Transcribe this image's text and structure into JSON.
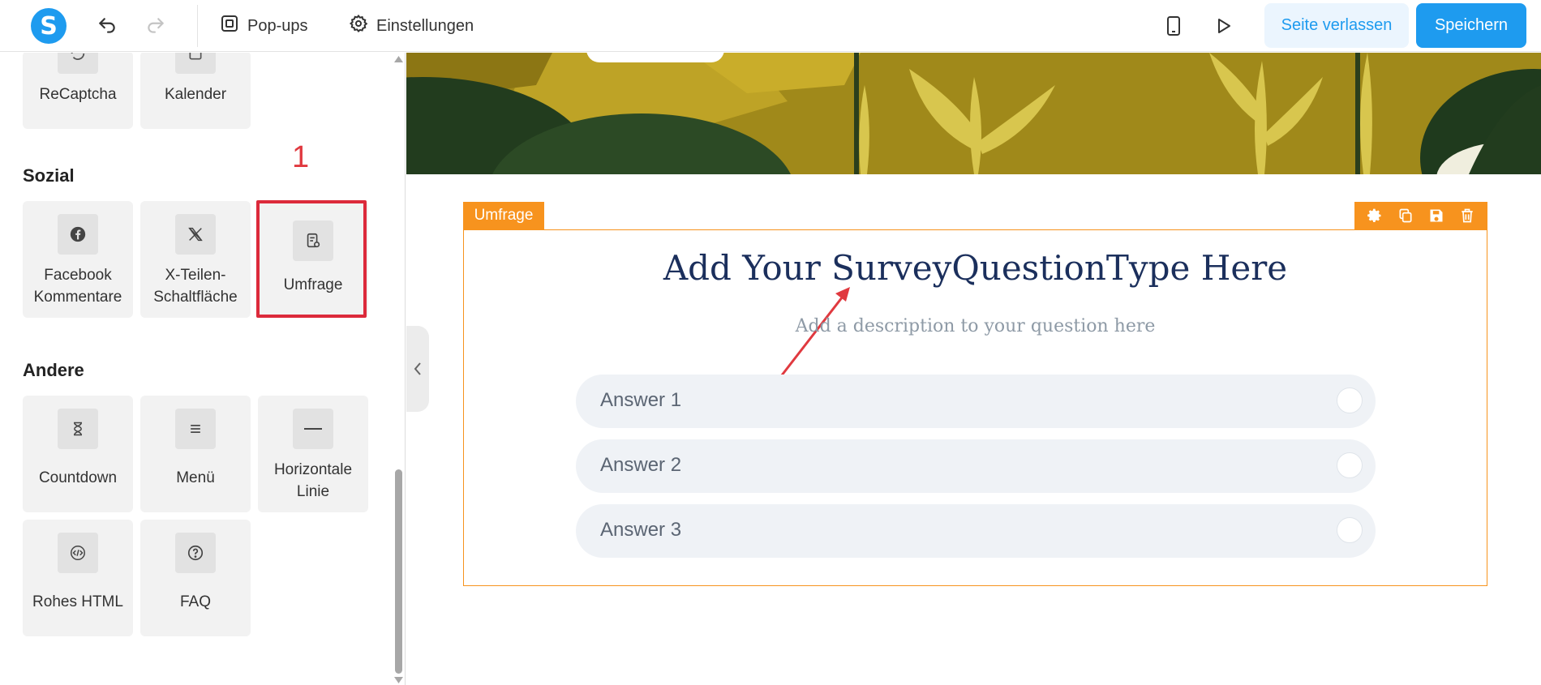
{
  "header": {
    "logo_letter": "S",
    "popups_label": "Pop-ups",
    "settings_label": "Einstellungen",
    "leave_label": "Seite verlassen",
    "save_label": "Speichern"
  },
  "sidebar": {
    "top_tiles": [
      {
        "label": "ReCaptcha",
        "icon": "recaptcha-icon"
      },
      {
        "label": "Kalender",
        "icon": "calendar-icon"
      }
    ],
    "sections": [
      {
        "title": "Sozial",
        "tiles": [
          {
            "label": "Facebook Kommentare",
            "icon": "facebook-icon"
          },
          {
            "label": "X-Teilen-Schaltfläche",
            "icon": "x-icon"
          },
          {
            "label": "Umfrage",
            "icon": "survey-icon"
          }
        ]
      },
      {
        "title": "Andere",
        "tiles": [
          {
            "label": "Countdown",
            "icon": "hourglass-icon"
          },
          {
            "label": "Menü",
            "icon": "menu-icon"
          },
          {
            "label": "Horizontale Linie",
            "icon": "horizontal-line-icon"
          },
          {
            "label": "Rohes HTML",
            "icon": "html-code-icon"
          },
          {
            "label": "FAQ",
            "icon": "question-icon"
          }
        ]
      }
    ],
    "annotation_number": "1"
  },
  "canvas": {
    "widget_tag": "Umfrage",
    "survey": {
      "title": "Add Your SurveyQuestionType Here",
      "description": "Add a description to your question here",
      "answers": [
        "Answer 1",
        "Answer 2",
        "Answer 3"
      ]
    }
  },
  "colors": {
    "brand_blue": "#1e9bef",
    "highlight_red": "#dc2a3b",
    "widget_orange": "#f7931e",
    "survey_title_navy": "#1b2f5c"
  }
}
